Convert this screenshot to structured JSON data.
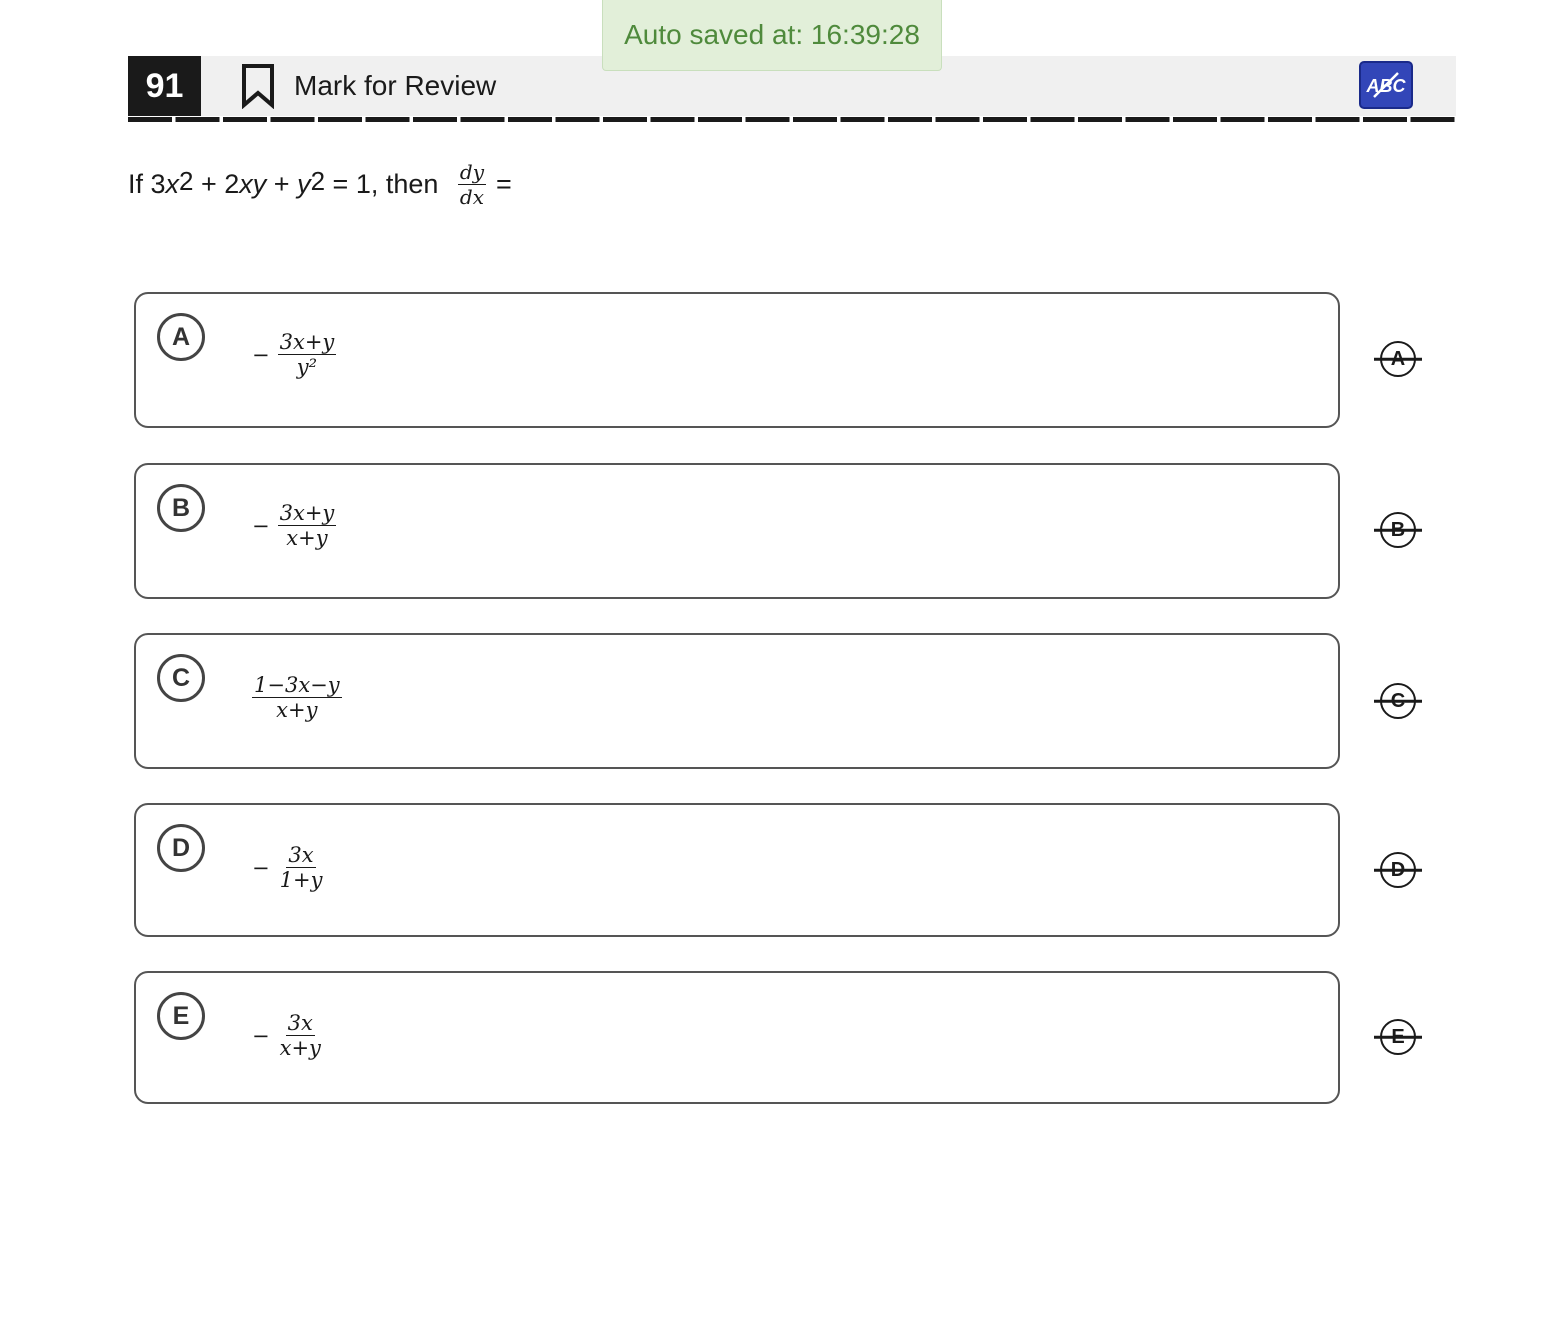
{
  "autosave": {
    "text": "Auto saved at: 16:39:28"
  },
  "header": {
    "question_number": "91",
    "mark_review_label": "Mark for Review",
    "eliminator_icon": "abc-strikethrough-icon",
    "eliminator_bg": "#3246b8"
  },
  "question": {
    "prefix": "If 3",
    "x": "x",
    "exp1": "2",
    "mid1": " + 2",
    "xy": "xy",
    "mid2": " + ",
    "y": "y",
    "exp2": "2",
    "mid3": " = 1, then ",
    "frac_num": "dy",
    "frac_den": "dx",
    "suffix": "="
  },
  "choices": [
    {
      "letter": "A",
      "sign": "−",
      "num": "3x+y",
      "den": "y²"
    },
    {
      "letter": "B",
      "sign": "−",
      "num": "3x+y",
      "den": "x+y"
    },
    {
      "letter": "C",
      "sign": "",
      "num": "1−3x−y",
      "den": "x+y"
    },
    {
      "letter": "D",
      "sign": "−",
      "num": "3x",
      "den": "1+y"
    },
    {
      "letter": "E",
      "sign": "−",
      "num": "3x",
      "den": "x+y"
    }
  ]
}
